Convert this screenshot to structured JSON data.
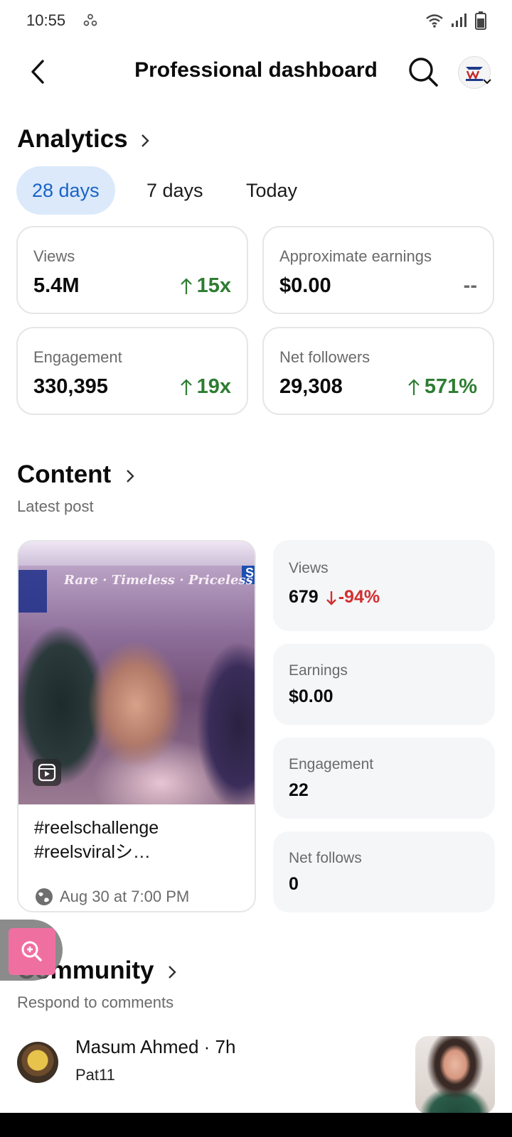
{
  "status_bar": {
    "time": "10:55"
  },
  "header": {
    "title": "Professional dashboard"
  },
  "analytics": {
    "title": "Analytics",
    "tabs": [
      "28 days",
      "7 days",
      "Today"
    ],
    "cards": [
      {
        "label": "Views",
        "value": "5.4M",
        "delta": "15x",
        "trend": "up"
      },
      {
        "label": "Approximate earnings",
        "value": "$0.00",
        "delta": "--",
        "trend": "none"
      },
      {
        "label": "Engagement",
        "value": "330,395",
        "delta": "19x",
        "trend": "up"
      },
      {
        "label": "Net followers",
        "value": "29,308",
        "delta": "571%",
        "trend": "up"
      }
    ]
  },
  "content": {
    "title": "Content",
    "subtitle": "Latest post",
    "post": {
      "thumbnail_text": "Rare · Timeless · Priceless",
      "thumbnail_corner_letter": "S",
      "caption_line1": "#reelschallenge",
      "caption_line2": "#reelsviralシ…",
      "date": "Aug 30 at 7:00 PM"
    },
    "stats": [
      {
        "label": "Views",
        "value": "679",
        "delta": "-94%",
        "trend": "down"
      },
      {
        "label": "Earnings",
        "value": "$0.00"
      },
      {
        "label": "Engagement",
        "value": "22"
      },
      {
        "label": "Net follows",
        "value": "0"
      }
    ]
  },
  "community": {
    "title": "Community",
    "subtitle": "Respond to comments",
    "comment": {
      "name": "Masum Ahmed · 7h",
      "text": "Pat11"
    }
  },
  "colors": {
    "accent": "#1a63c7",
    "positive": "#2e7d32",
    "negative": "#d32f2f",
    "tab_active_bg": "#dbe9fb"
  }
}
